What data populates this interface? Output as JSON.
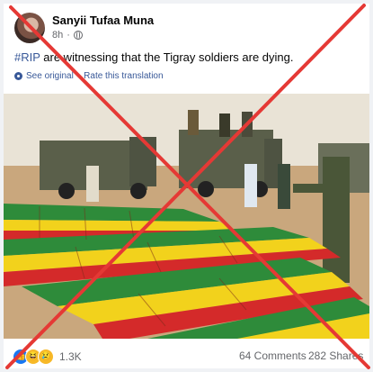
{
  "post": {
    "author": "Sanyii Tufaa Muna",
    "time": "8h",
    "audience_icon": "globe-icon",
    "hashtag": "#RIP",
    "text": " are witnessing that the Tigray soldiers are dying.",
    "see_original": "See original",
    "rate_translation": "Rate this translation",
    "separator": "·"
  },
  "photo": {
    "icon": "photo-coffins-soldiers",
    "colors": {
      "green": "#2e8b3a",
      "yellow": "#f2d21c",
      "red": "#d42a2a",
      "sky": "#e8e0d2",
      "ground": "#c9a77d"
    }
  },
  "footer": {
    "reaction_icons": [
      "like-icon",
      "haha-icon",
      "sad-icon"
    ],
    "reactions_count": "1.3K",
    "comments": "64 Comments",
    "shares": "282 Shares"
  },
  "overlay": {
    "color": "#e53935",
    "icon": "red-cross-mark"
  }
}
